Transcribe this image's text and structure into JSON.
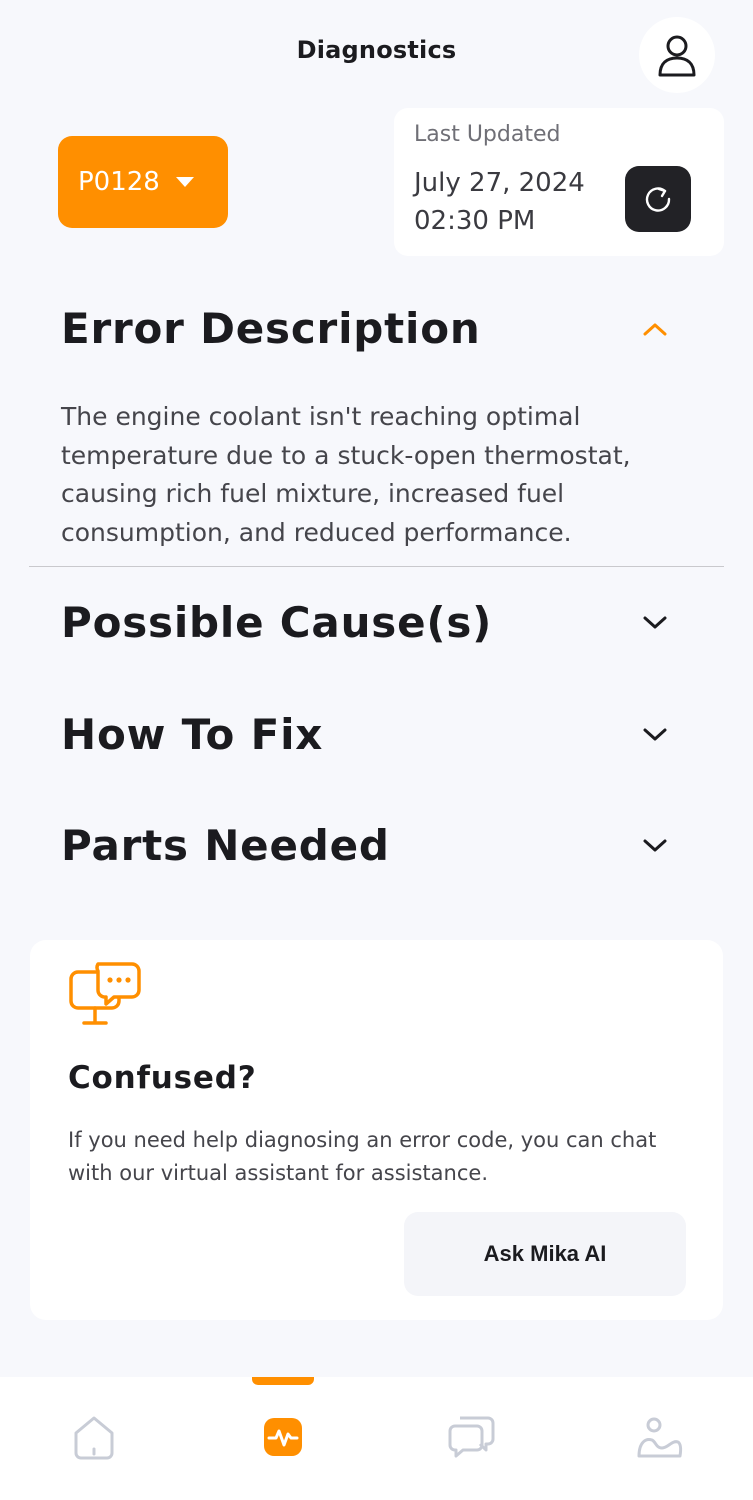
{
  "header": {
    "title": "Diagnostics"
  },
  "code_selector": {
    "value": "P0128"
  },
  "last_updated": {
    "label": "Last Updated",
    "date": "July 27, 2024",
    "time": "02:30 PM"
  },
  "sections": [
    {
      "title": "Error Description",
      "expanded": true,
      "body": "The engine coolant isn't reaching optimal temperature due to a stuck-open thermostat, causing rich fuel mixture, increased fuel consumption, and reduced performance."
    },
    {
      "title": "Possible Cause(s)",
      "expanded": false
    },
    {
      "title": "How To Fix",
      "expanded": false
    },
    {
      "title": "Parts Needed",
      "expanded": false
    }
  ],
  "help_card": {
    "icon": "chat-monitor-icon",
    "title": "Confused?",
    "text": "If you need help diagnosing an error code, you can chat with our virtual assistant for assistance.",
    "button": "Ask Mika AI"
  },
  "tabbar": {
    "active_index": 1,
    "tabs": [
      {
        "icon": "home-icon"
      },
      {
        "icon": "diagnostics-icon"
      },
      {
        "icon": "chat-icon"
      },
      {
        "icon": "profile-icon"
      }
    ]
  },
  "colors": {
    "accent": "#ff8f00",
    "background": "#f7f8fc",
    "dark": "#222226",
    "inactive_icon": "#c8ccd6"
  }
}
